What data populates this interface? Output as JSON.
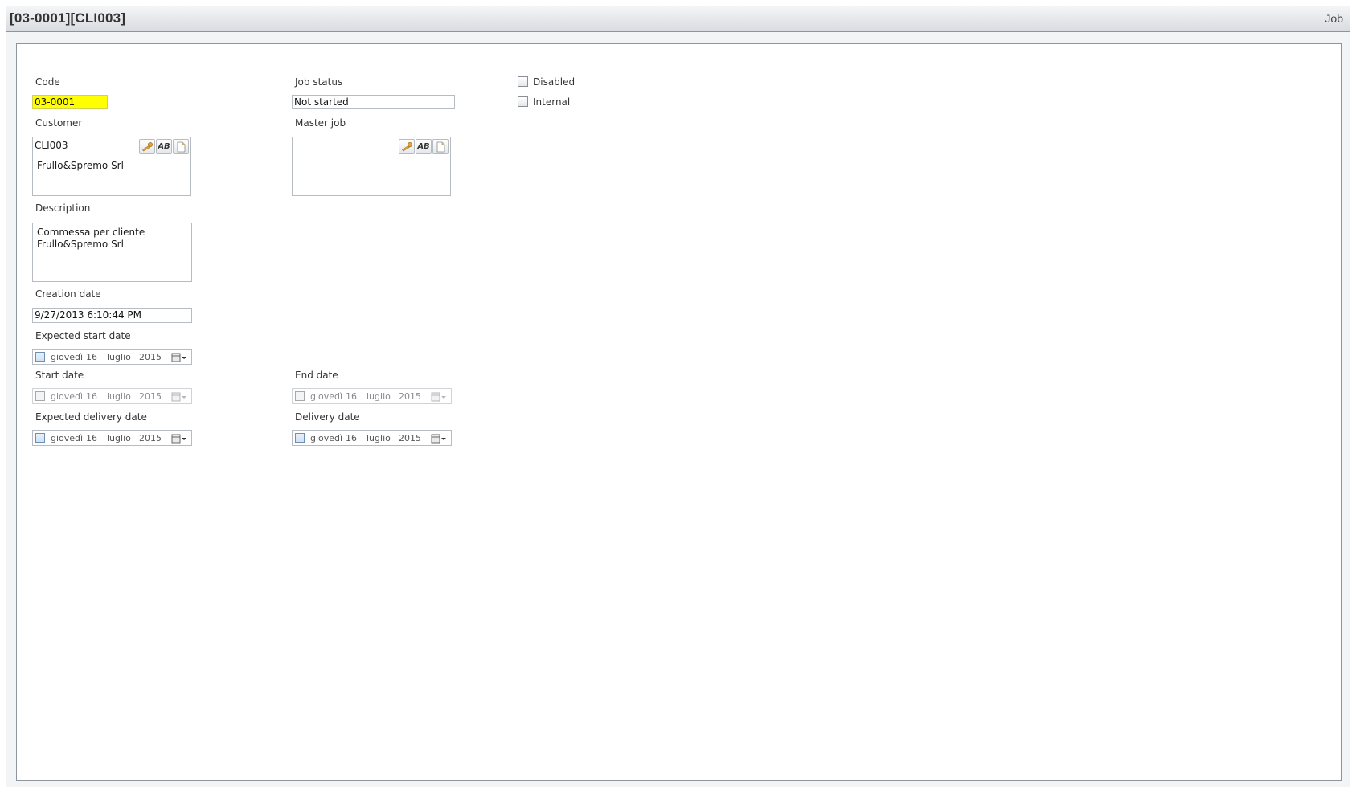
{
  "window": {
    "title": "[03-0001][CLI003]",
    "context_label": "Job"
  },
  "form": {
    "code": {
      "label": "Code",
      "value": "03-0001"
    },
    "job_status": {
      "label": "Job status",
      "value": "Not started"
    },
    "disabled": {
      "label": "Disabled",
      "checked": false
    },
    "internal": {
      "label": "Internal",
      "checked": false
    },
    "customer": {
      "label": "Customer",
      "code": "CLI003",
      "name": "Frullo&Spremo Srl",
      "ab_label": "AB"
    },
    "master_job": {
      "label": "Master job",
      "code": "",
      "name": "",
      "ab_label": "AB"
    },
    "description": {
      "label": "Description",
      "line1": "Commessa per cliente",
      "line2": "Frullo&Spremo Srl"
    },
    "creation_date": {
      "label": "Creation date",
      "value": "9/27/2013 6:10:44 PM"
    },
    "expected_start_date": {
      "label": "Expected start date",
      "weekday": "giovedì",
      "day": "16",
      "month": "luglio",
      "year": "2015",
      "enabled": true
    },
    "start_date": {
      "label": "Start date",
      "weekday": "giovedì",
      "day": "16",
      "month": "luglio",
      "year": "2015",
      "enabled": false
    },
    "end_date": {
      "label": "End date",
      "weekday": "giovedì",
      "day": "16",
      "month": "luglio",
      "year": "2015",
      "enabled": false
    },
    "expected_delivery_date": {
      "label": "Expected delivery date",
      "weekday": "giovedì",
      "day": "16",
      "month": "luglio",
      "year": "2015",
      "enabled": true
    },
    "delivery_date": {
      "label": "Delivery date",
      "weekday": "giovedì",
      "day": "16",
      "month": "luglio",
      "year": "2015",
      "enabled": true
    }
  },
  "icons": [
    "key-icon",
    "new-document-icon",
    "calendar-icon",
    "chevron-down-icon"
  ],
  "colors": {
    "code_highlight": "#ffff00",
    "checkbox_accent": "#6f8fb3",
    "title_text": "#333333"
  }
}
